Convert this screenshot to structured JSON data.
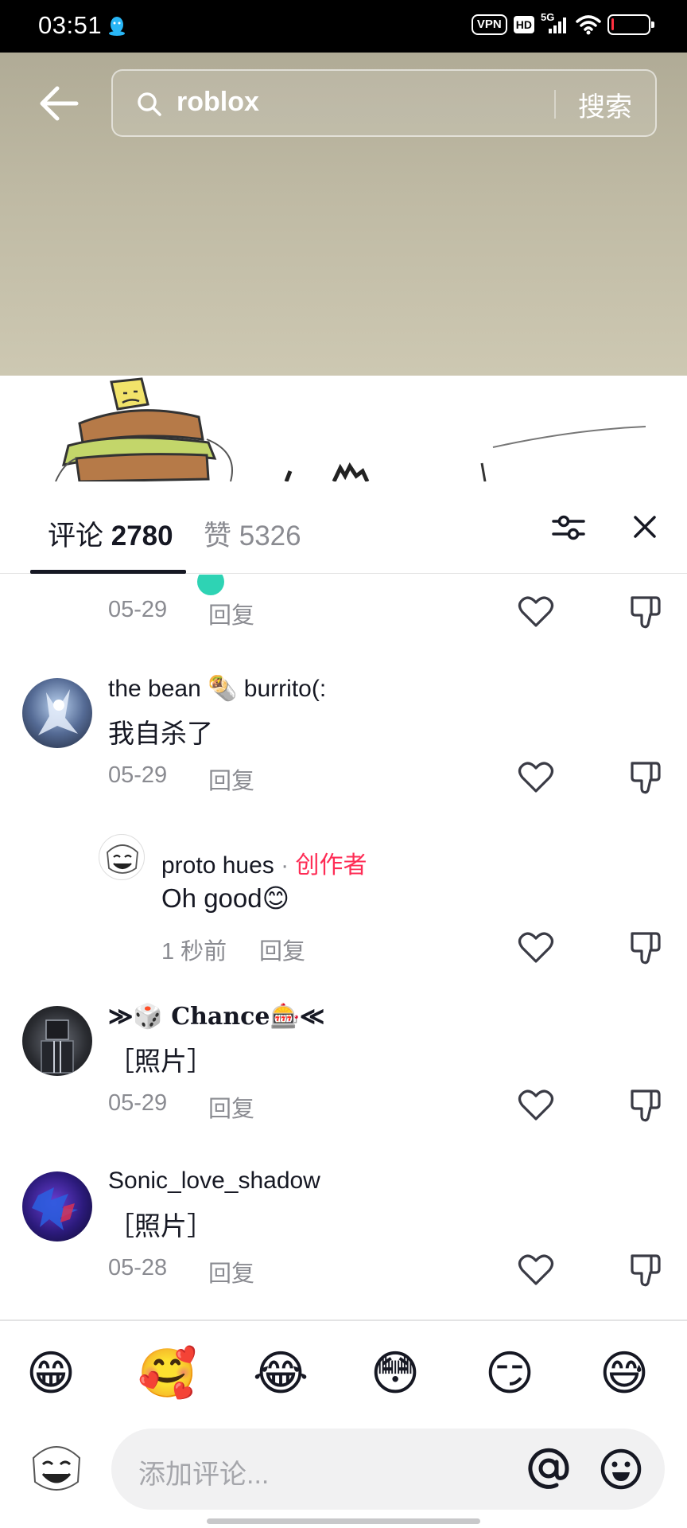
{
  "status_bar": {
    "time": "03:51",
    "vpn": "VPN",
    "hd": "HD",
    "network": "5G",
    "icons": [
      "qq-icon",
      "signal-icon",
      "wifi-icon",
      "battery-icon"
    ]
  },
  "search": {
    "query": "roblox",
    "button_label": "搜索"
  },
  "panel": {
    "tabs": [
      {
        "label": "评论",
        "count": "2780"
      },
      {
        "label": "赞",
        "count": "5326"
      }
    ]
  },
  "comments": [
    {
      "date": "05-29",
      "reply_label": "回复"
    },
    {
      "username": "the bean 🌯 burrito(:",
      "text": "我自杀了",
      "date": "05-29",
      "reply_label": "回复"
    },
    {
      "username": "proto hues",
      "separator": "·",
      "badge": "创作者",
      "text": "Oh good😊",
      "date": "1 秒前",
      "reply_label": "回复"
    },
    {
      "username": "≫🎲 Chance🎰≪",
      "text": "［照片］",
      "date": "05-29",
      "reply_label": "回复"
    },
    {
      "username": "Sonic_love_shadow",
      "text": "［照片］",
      "date": "05-28",
      "reply_label": "回复"
    }
  ],
  "emoji_bar": [
    "😁",
    "🥰",
    "😂",
    "😳",
    "😏",
    "😅"
  ],
  "input": {
    "placeholder": "添加评论..."
  },
  "colors": {
    "accent": "#fe2c55",
    "text_primary": "#161823",
    "text_secondary": "#8a8b91"
  }
}
